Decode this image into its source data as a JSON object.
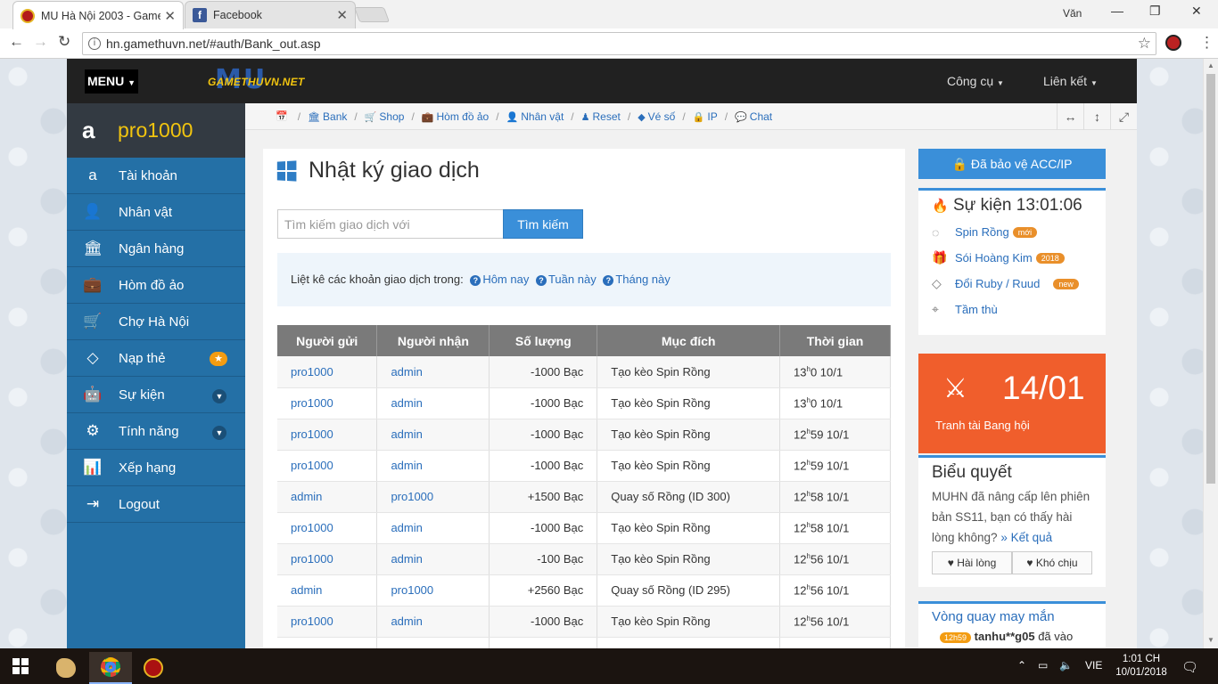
{
  "browser": {
    "tabs": [
      {
        "title": "MU Hà Nội 2003 - Game",
        "active": true
      },
      {
        "title": "Facebook",
        "active": false
      }
    ],
    "user": "Văn",
    "url": "hn.gamethuvn.net/#auth/Bank_out.asp"
  },
  "site": {
    "menu_label": "MENU",
    "logo_mu": "MU",
    "logo_text": "GAMETHUVN.NET",
    "top_menu": [
      {
        "label": "Công cụ"
      },
      {
        "label": "Liên kết"
      }
    ]
  },
  "sidebar": {
    "username": "pro1000",
    "items": [
      {
        "label": "Tài khoản",
        "icon": "amazon-icon"
      },
      {
        "label": "Nhân vật",
        "icon": "user-icon"
      },
      {
        "label": "Ngân hàng",
        "icon": "bank-icon"
      },
      {
        "label": "Hòm đồ ảo",
        "icon": "briefcase-icon"
      },
      {
        "label": "Chợ Hà Nội",
        "icon": "cart-icon"
      },
      {
        "label": "Nạp thẻ",
        "icon": "diamond-icon"
      },
      {
        "label": "Sự kiện",
        "icon": "android-icon"
      },
      {
        "label": "Tính năng",
        "icon": "cogs-icon"
      },
      {
        "label": "Xếp hạng",
        "icon": "bar-chart-icon"
      },
      {
        "label": "Logout",
        "icon": "sign-out-icon"
      }
    ]
  },
  "breadcrumb": [
    {
      "label": "Bank",
      "icon": "bank-icon"
    },
    {
      "label": "Shop",
      "icon": "cart-icon"
    },
    {
      "label": "Hòm đồ ảo",
      "icon": "briefcase-icon"
    },
    {
      "label": "Nhân vật",
      "icon": "user-icon"
    },
    {
      "label": "Reset",
      "icon": "reset-icon"
    },
    {
      "label": "Vé số",
      "icon": "ticket-icon"
    },
    {
      "label": "IP",
      "icon": "lock-icon"
    },
    {
      "label": "Chat",
      "icon": "chat-icon"
    }
  ],
  "main": {
    "title": "Nhật ký giao dịch",
    "search_placeholder": "Tìm kiếm giao dịch với",
    "search_button": "Tìm kiếm",
    "filter_intro": "Liệt kê các khoản giao dịch trong:",
    "filters": [
      "Hôm nay",
      "Tuần này",
      "Tháng này"
    ],
    "table": {
      "headers": [
        "Người gửi",
        "Người nhận",
        "Số lượng",
        "Mục đích",
        "Thời gian"
      ],
      "rows": [
        {
          "sender": "pro1000",
          "receiver": "admin",
          "amount": "-1000  Bạc",
          "purpose": "Tạo kèo Spin Rồng",
          "hour": "13",
          "rest": "0 10/1"
        },
        {
          "sender": "pro1000",
          "receiver": "admin",
          "amount": "-1000  Bạc",
          "purpose": "Tạo kèo Spin Rồng",
          "hour": "13",
          "rest": "0 10/1"
        },
        {
          "sender": "pro1000",
          "receiver": "admin",
          "amount": "-1000  Bạc",
          "purpose": "Tạo kèo Spin Rồng",
          "hour": "12",
          "rest": "59 10/1"
        },
        {
          "sender": "pro1000",
          "receiver": "admin",
          "amount": "-1000  Bạc",
          "purpose": "Tạo kèo Spin Rồng",
          "hour": "12",
          "rest": "59 10/1"
        },
        {
          "sender": "admin",
          "receiver": "pro1000",
          "amount": "+1500  Bạc",
          "purpose": "Quay số Rồng (ID 300)",
          "hour": "12",
          "rest": "58 10/1"
        },
        {
          "sender": "pro1000",
          "receiver": "admin",
          "amount": "-1000  Bạc",
          "purpose": "Tạo kèo Spin Rồng",
          "hour": "12",
          "rest": "58 10/1"
        },
        {
          "sender": "pro1000",
          "receiver": "admin",
          "amount": "-100  Bạc",
          "purpose": "Tạo kèo Spin Rồng",
          "hour": "12",
          "rest": "56 10/1"
        },
        {
          "sender": "admin",
          "receiver": "pro1000",
          "amount": "+2560  Bạc",
          "purpose": "Quay số Rồng (ID 295)",
          "hour": "12",
          "rest": "56 10/1"
        },
        {
          "sender": "pro1000",
          "receiver": "admin",
          "amount": "-1000  Bạc",
          "purpose": "Tạo kèo Spin Rồng",
          "hour": "12",
          "rest": "56 10/1"
        }
      ]
    }
  },
  "right": {
    "protect_button": "Đã bảo vệ ACC/IP",
    "event_title": "Sự kiện 13:01:06",
    "events": [
      {
        "label": "Spin Rồng",
        "badge": "mới",
        "icon": "spinner-icon"
      },
      {
        "label": "Sói Hoàng Kim",
        "badge": "2018",
        "icon": "gift-icon"
      },
      {
        "label": "Đổi Ruby / Ruud",
        "badge": "new",
        "icon": "diamond-icon"
      },
      {
        "label": "Tầm thù",
        "badge": "",
        "icon": "crosshair-icon"
      }
    ],
    "tournament": {
      "date": "14/01",
      "name": "Tranh tài Bang hội"
    },
    "poll": {
      "title": "Biểu quyết",
      "question": "MUHN đã nâng cấp lên phiên bản SS11, bạn có thấy hài lòng không?",
      "result_link": "» Kết quả",
      "options": [
        "Hài lòng",
        "Khó chịu"
      ]
    },
    "wheel": {
      "title": "Vòng quay may mắn",
      "entry_time": "12h59",
      "entry_name": "tanhu**g05",
      "entry_text": "đã vào"
    }
  },
  "taskbar": {
    "lang": "VIE",
    "time": "1:01 CH",
    "date": "10/01/2018"
  }
}
